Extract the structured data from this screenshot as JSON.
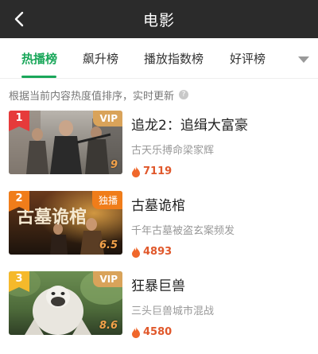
{
  "header": {
    "title": "电影"
  },
  "tabs": [
    {
      "label": "热播榜",
      "active": true
    },
    {
      "label": "飙升榜",
      "active": false
    },
    {
      "label": "播放指数榜",
      "active": false
    },
    {
      "label": "好评榜",
      "active": false
    }
  ],
  "notice": {
    "text": "根据当前内容热度值排序，实时更新"
  },
  "colors": {
    "accent": "#1aa75a",
    "header_bg": "#2b2b2b",
    "heat": "#e0582b",
    "vip": "#d9a35a"
  },
  "items": [
    {
      "rank": "1",
      "badge": "VIP",
      "title": "追龙2：追缉大富豪",
      "desc": "古天乐搏命梁家辉",
      "heat": "7119",
      "score": "9",
      "rank_color": "#e63b3b"
    },
    {
      "rank": "2",
      "badge": "独播",
      "title": "古墓诡棺",
      "desc": "千年古墓被盗玄案频发",
      "heat": "4893",
      "score": "6.5",
      "rank_color": "#f07d1a",
      "poster_text": "古墓诡棺"
    },
    {
      "rank": "3",
      "badge": "VIP",
      "title": "狂暴巨兽",
      "desc": "三头巨兽城市混战",
      "heat": "4580",
      "score": "8.6",
      "rank_color": "#f5b92b"
    }
  ]
}
